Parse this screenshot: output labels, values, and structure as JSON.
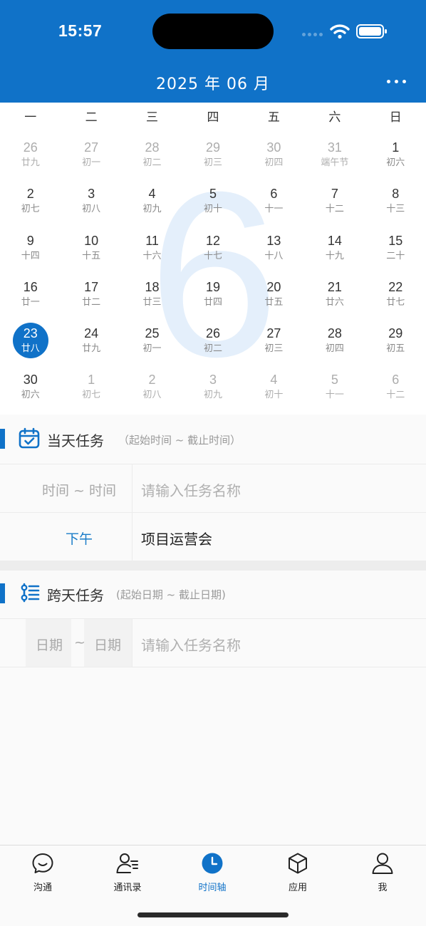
{
  "status_bar": {
    "time": "15:57"
  },
  "header": {
    "title": "2025 年 06 月"
  },
  "calendar": {
    "weekdays": [
      "一",
      "二",
      "三",
      "四",
      "五",
      "六",
      "日"
    ],
    "watermark_month": "6",
    "days": [
      {
        "n": "26",
        "l": "廿九",
        "cur": false
      },
      {
        "n": "27",
        "l": "初一",
        "cur": false
      },
      {
        "n": "28",
        "l": "初二",
        "cur": false
      },
      {
        "n": "29",
        "l": "初三",
        "cur": false
      },
      {
        "n": "30",
        "l": "初四",
        "cur": false
      },
      {
        "n": "31",
        "l": "端午节",
        "cur": false
      },
      {
        "n": "1",
        "l": "初六",
        "cur": true
      },
      {
        "n": "2",
        "l": "初七",
        "cur": true
      },
      {
        "n": "3",
        "l": "初八",
        "cur": true
      },
      {
        "n": "4",
        "l": "初九",
        "cur": true
      },
      {
        "n": "5",
        "l": "初十",
        "cur": true
      },
      {
        "n": "6",
        "l": "十一",
        "cur": true
      },
      {
        "n": "7",
        "l": "十二",
        "cur": true
      },
      {
        "n": "8",
        "l": "十三",
        "cur": true
      },
      {
        "n": "9",
        "l": "十四",
        "cur": true
      },
      {
        "n": "10",
        "l": "十五",
        "cur": true
      },
      {
        "n": "11",
        "l": "十六",
        "cur": true
      },
      {
        "n": "12",
        "l": "十七",
        "cur": true
      },
      {
        "n": "13",
        "l": "十八",
        "cur": true
      },
      {
        "n": "14",
        "l": "十九",
        "cur": true
      },
      {
        "n": "15",
        "l": "二十",
        "cur": true
      },
      {
        "n": "16",
        "l": "廿一",
        "cur": true
      },
      {
        "n": "17",
        "l": "廿二",
        "cur": true
      },
      {
        "n": "18",
        "l": "廿三",
        "cur": true
      },
      {
        "n": "19",
        "l": "廿四",
        "cur": true
      },
      {
        "n": "20",
        "l": "廿五",
        "cur": true
      },
      {
        "n": "21",
        "l": "廿六",
        "cur": true
      },
      {
        "n": "22",
        "l": "廿七",
        "cur": true
      },
      {
        "n": "23",
        "l": "廿八",
        "cur": true,
        "selected": true
      },
      {
        "n": "24",
        "l": "廿九",
        "cur": true
      },
      {
        "n": "25",
        "l": "初一",
        "cur": true
      },
      {
        "n": "26",
        "l": "初二",
        "cur": true
      },
      {
        "n": "27",
        "l": "初三",
        "cur": true
      },
      {
        "n": "28",
        "l": "初四",
        "cur": true
      },
      {
        "n": "29",
        "l": "初五",
        "cur": true
      },
      {
        "n": "30",
        "l": "初六",
        "cur": true
      },
      {
        "n": "1",
        "l": "初七",
        "cur": false
      },
      {
        "n": "2",
        "l": "初八",
        "cur": false
      },
      {
        "n": "3",
        "l": "初九",
        "cur": false
      },
      {
        "n": "4",
        "l": "初十",
        "cur": false
      },
      {
        "n": "5",
        "l": "十一",
        "cur": false
      },
      {
        "n": "6",
        "l": "十二",
        "cur": false
      }
    ]
  },
  "day_tasks": {
    "title": "当天任务",
    "hint": "（起始时间 ~ 截止时间）",
    "new_row": {
      "time_placeholder": "时间 ~ 时间",
      "name_placeholder": "请输入任务名称"
    },
    "items": [
      {
        "time": "下午",
        "name": "项目运营会"
      }
    ]
  },
  "multi_day_tasks": {
    "title": "跨天任务",
    "hint": "(起始日期 ~ 截止日期)",
    "new_row": {
      "start_placeholder": "日期",
      "separator": "~",
      "end_placeholder": "日期",
      "name_placeholder": "请输入任务名称"
    }
  },
  "bottom_nav": [
    {
      "label": "沟通",
      "icon": "chat-icon"
    },
    {
      "label": "通讯录",
      "icon": "contacts-icon"
    },
    {
      "label": "时间轴",
      "icon": "clock-icon",
      "active": true
    },
    {
      "label": "应用",
      "icon": "cube-icon"
    },
    {
      "label": "我",
      "icon": "person-icon"
    }
  ],
  "colors": {
    "primary": "#1072c8",
    "watermark": "#e4effb"
  }
}
